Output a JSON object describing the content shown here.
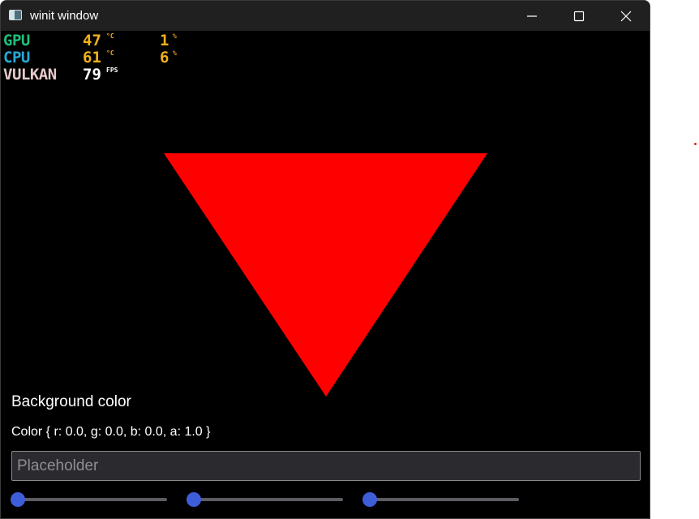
{
  "window": {
    "title": "winit window",
    "background_color": "#000000"
  },
  "overlay": {
    "gpu": {
      "label": "GPU",
      "temp": "47",
      "temp_unit": "°C",
      "usage": "1",
      "usage_unit": "%",
      "color": "#1fbf7a"
    },
    "cpu": {
      "label": "CPU",
      "temp": "61",
      "temp_unit": "°C",
      "usage": "6",
      "usage_unit": "%",
      "color": "#27a9d6"
    },
    "api": {
      "label": "VULKAN",
      "fps": "79",
      "fps_unit": "FPS",
      "color": "#e6c9c9"
    },
    "value_color": "#f2b01e"
  },
  "scene": {
    "triangle_color": "#ff0000"
  },
  "controls": {
    "background_label": "Background color",
    "color_readout": "Color { r: 0.0, g: 0.0, b: 0.0, a: 1.0 }",
    "text_input": {
      "value": "",
      "placeholder": "Placeholder"
    },
    "sliders": [
      {
        "name": "r",
        "value": 0.0
      },
      {
        "name": "g",
        "value": 0.0
      },
      {
        "name": "b",
        "value": 0.0
      }
    ],
    "accent_color": "#3d5ed8"
  }
}
